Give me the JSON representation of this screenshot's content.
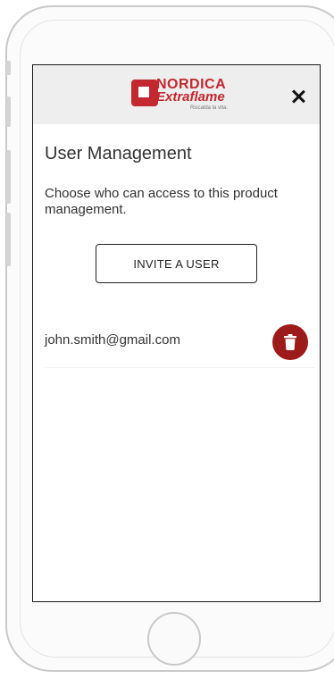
{
  "header": {
    "logo": {
      "brand_line1": "NORDICA",
      "brand_line2": "Extraflame",
      "tagline": "Riscalda la vita."
    },
    "close_icon": "close-icon"
  },
  "main": {
    "title": "User Management",
    "description": "Choose who can access to this product management.",
    "invite_button_label": "INVITE A USER",
    "users": [
      {
        "email": "john.smith@gmail.com",
        "delete_icon": "trash-icon"
      }
    ]
  },
  "colors": {
    "brand_red": "#c3272f",
    "delete_red": "#9c1a1a",
    "header_bg": "#eeeeee"
  }
}
